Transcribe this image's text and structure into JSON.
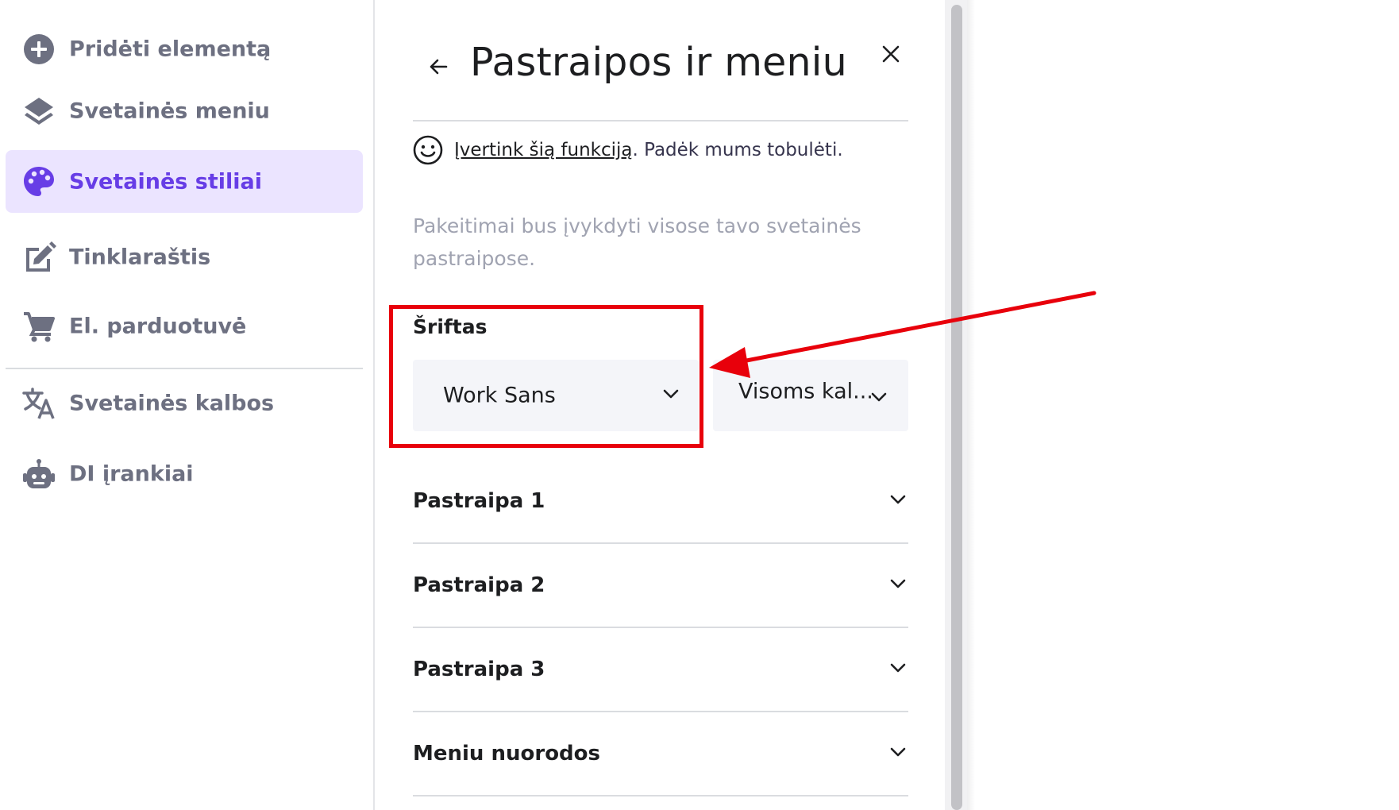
{
  "sidebar": {
    "items": [
      {
        "label": "Pridėti elementą",
        "icon": "plus-circle-icon"
      },
      {
        "label": "Svetainės meniu",
        "icon": "layers-icon"
      },
      {
        "label": "Svetainės stiliai",
        "icon": "palette-icon",
        "active": true
      },
      {
        "label": "Tinklaraštis",
        "icon": "edit-icon"
      },
      {
        "label": "El. parduotuvė",
        "icon": "cart-icon"
      },
      {
        "label": "Svetainės kalbos",
        "icon": "translate-icon"
      },
      {
        "label": "DI įrankiai",
        "icon": "robot-icon"
      }
    ]
  },
  "panel": {
    "title": "Pastraipos ir meniu",
    "feedback": {
      "link": "Įvertink šią funkciją",
      "text": ". Padėk mums tobulėti."
    },
    "helper": "Pakeitimai bus įvykdyti visose tavo svetainės pastraipose.",
    "font_label": "Šriftas",
    "font_value": "Work Sans",
    "language_value": "Visoms kal...",
    "accordion": [
      {
        "label": "Pastraipa 1"
      },
      {
        "label": "Pastraipa 2"
      },
      {
        "label": "Pastraipa 3"
      },
      {
        "label": "Meniu nuorodos"
      }
    ]
  },
  "colors": {
    "accent": "#673de6",
    "active_bg": "#ebe4ff",
    "sidebar_text": "#6d7081",
    "annotation": "#e8000b"
  }
}
